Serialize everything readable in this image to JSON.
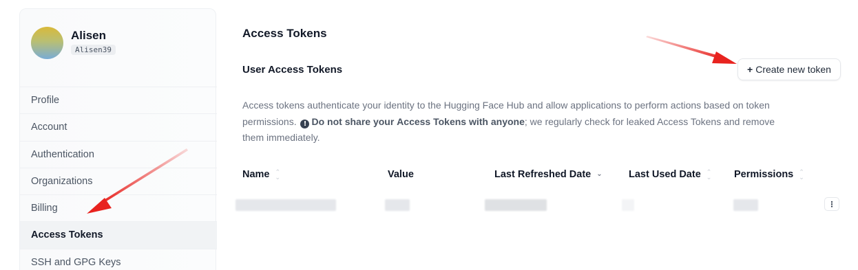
{
  "user": {
    "name": "Alisen",
    "handle": "Alisen39"
  },
  "sidebar": {
    "items": [
      {
        "label": "Profile",
        "active": false
      },
      {
        "label": "Account",
        "active": false
      },
      {
        "label": "Authentication",
        "active": false
      },
      {
        "label": "Organizations",
        "active": false
      },
      {
        "label": "Billing",
        "active": false
      },
      {
        "label": "Access Tokens",
        "active": true
      },
      {
        "label": "SSH and GPG Keys",
        "active": false
      }
    ]
  },
  "main": {
    "title": "Access Tokens",
    "section_title": "User Access Tokens",
    "create_button_label": "Create new token",
    "create_button_icon": "+",
    "description": {
      "part1": "Access tokens authenticate your identity to the Hugging Face Hub and allow applications to perform actions based on token permissions.",
      "warning_icon": "info-icon",
      "bold1": "Do not share your",
      "bold2": "Access Tokens",
      "bold3": "with anyone",
      "part2": "; we regularly check for leaked Access Tokens and remove them immediately."
    },
    "table": {
      "columns": [
        "Name",
        "Value",
        "Last Refreshed Date",
        "Last Used Date",
        "Permissions"
      ],
      "sorted_column": "Last Refreshed Date",
      "rows_redacted": true
    }
  },
  "colors": {
    "annotation_arrow": "#e8231f",
    "active_nav_bg": "#f1f3f5"
  }
}
